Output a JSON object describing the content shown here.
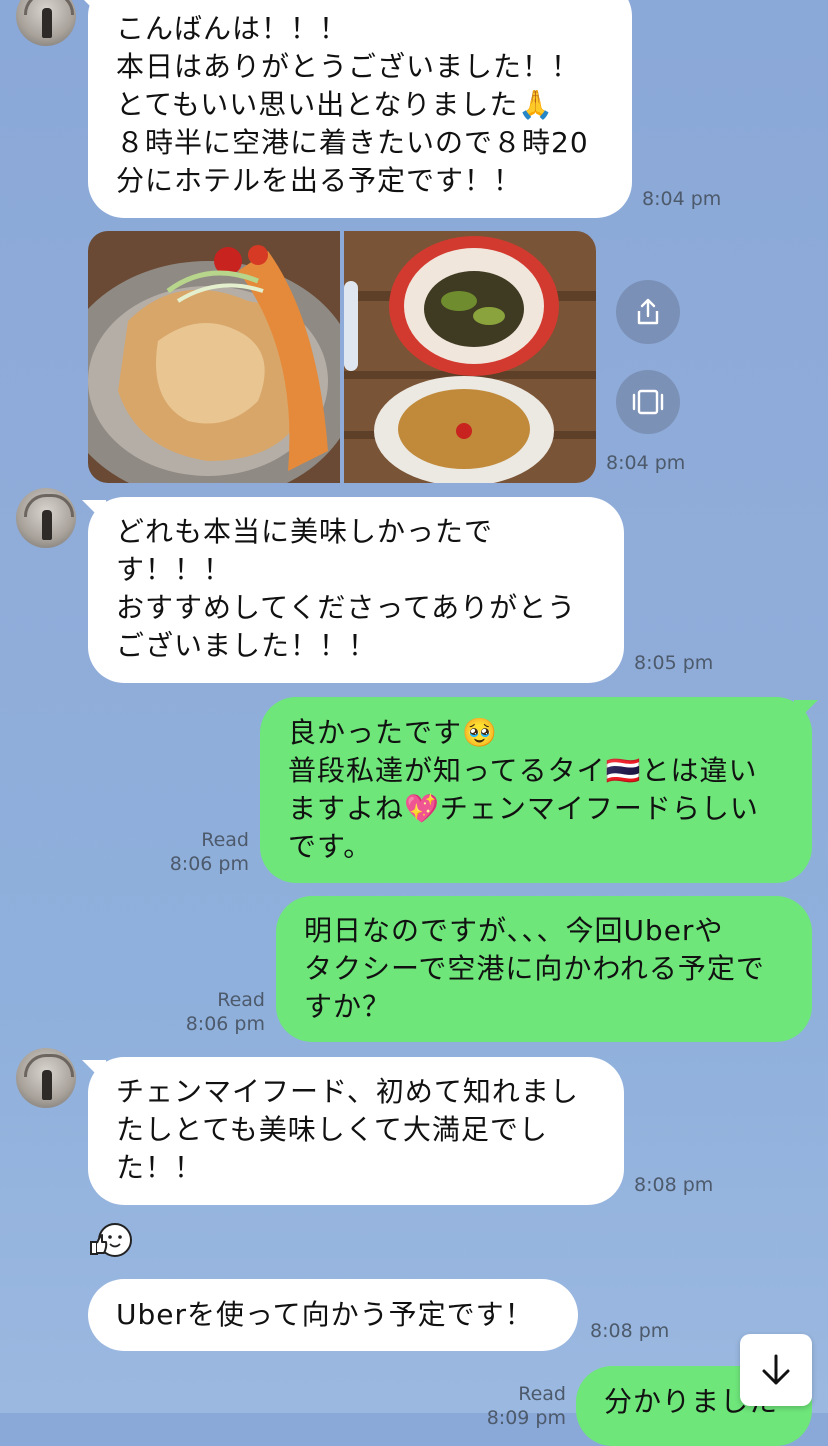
{
  "messages": {
    "m1": {
      "lines": [
        "こんばんは！！！",
        "本日はありがとうございました！！",
        "とてもいい思い出となりました🙏",
        "８時半に空港に着きたいので８時20",
        "分にホテルを出る予定です！！"
      ],
      "time": "8:04 pm"
    },
    "photos": {
      "time": "8:04 pm"
    },
    "m2": {
      "lines": [
        "どれも本当に美味しかったで",
        "す！！！",
        "おすすめしてくださってありがとう",
        "ございました！！！"
      ],
      "time": "8:05 pm"
    },
    "m3": {
      "lines": [
        "良かったです🥹",
        "普段私達が知ってるタイ🇹🇭とは違い",
        "ますよね💖チェンマイフードらしい",
        "です。"
      ],
      "read": "Read",
      "time": "8:06 pm"
    },
    "m4": {
      "lines": [
        "明日なのですが、、、今回Uberや",
        "タクシーで空港に向かわれる予定で",
        "すか？"
      ],
      "read": "Read",
      "time": "8:06 pm"
    },
    "m5": {
      "lines": [
        "チェンマイフード、初めて知れまし",
        "たしとても美味しくて大満足でし",
        "た！！"
      ],
      "time": "8:08 pm"
    },
    "m6": {
      "lines": [
        "Uberを使って向かう予定です！"
      ],
      "time": "8:08 pm"
    },
    "m7": {
      "lines": [
        "分かりました"
      ],
      "read": "Read",
      "time": "8:09 pm"
    }
  },
  "icons": {
    "share": "share-icon",
    "gallery": "gallery-icon",
    "scroll": "arrow-down-icon",
    "sticker": "thumbs-up-sticker-icon",
    "avatar": "avatar-icon"
  },
  "colors": {
    "background": "#8fabd9",
    "incoming_bubble": "#ffffff",
    "outgoing_bubble": "#6ee67a",
    "meta_text": "#4d5a6b"
  }
}
